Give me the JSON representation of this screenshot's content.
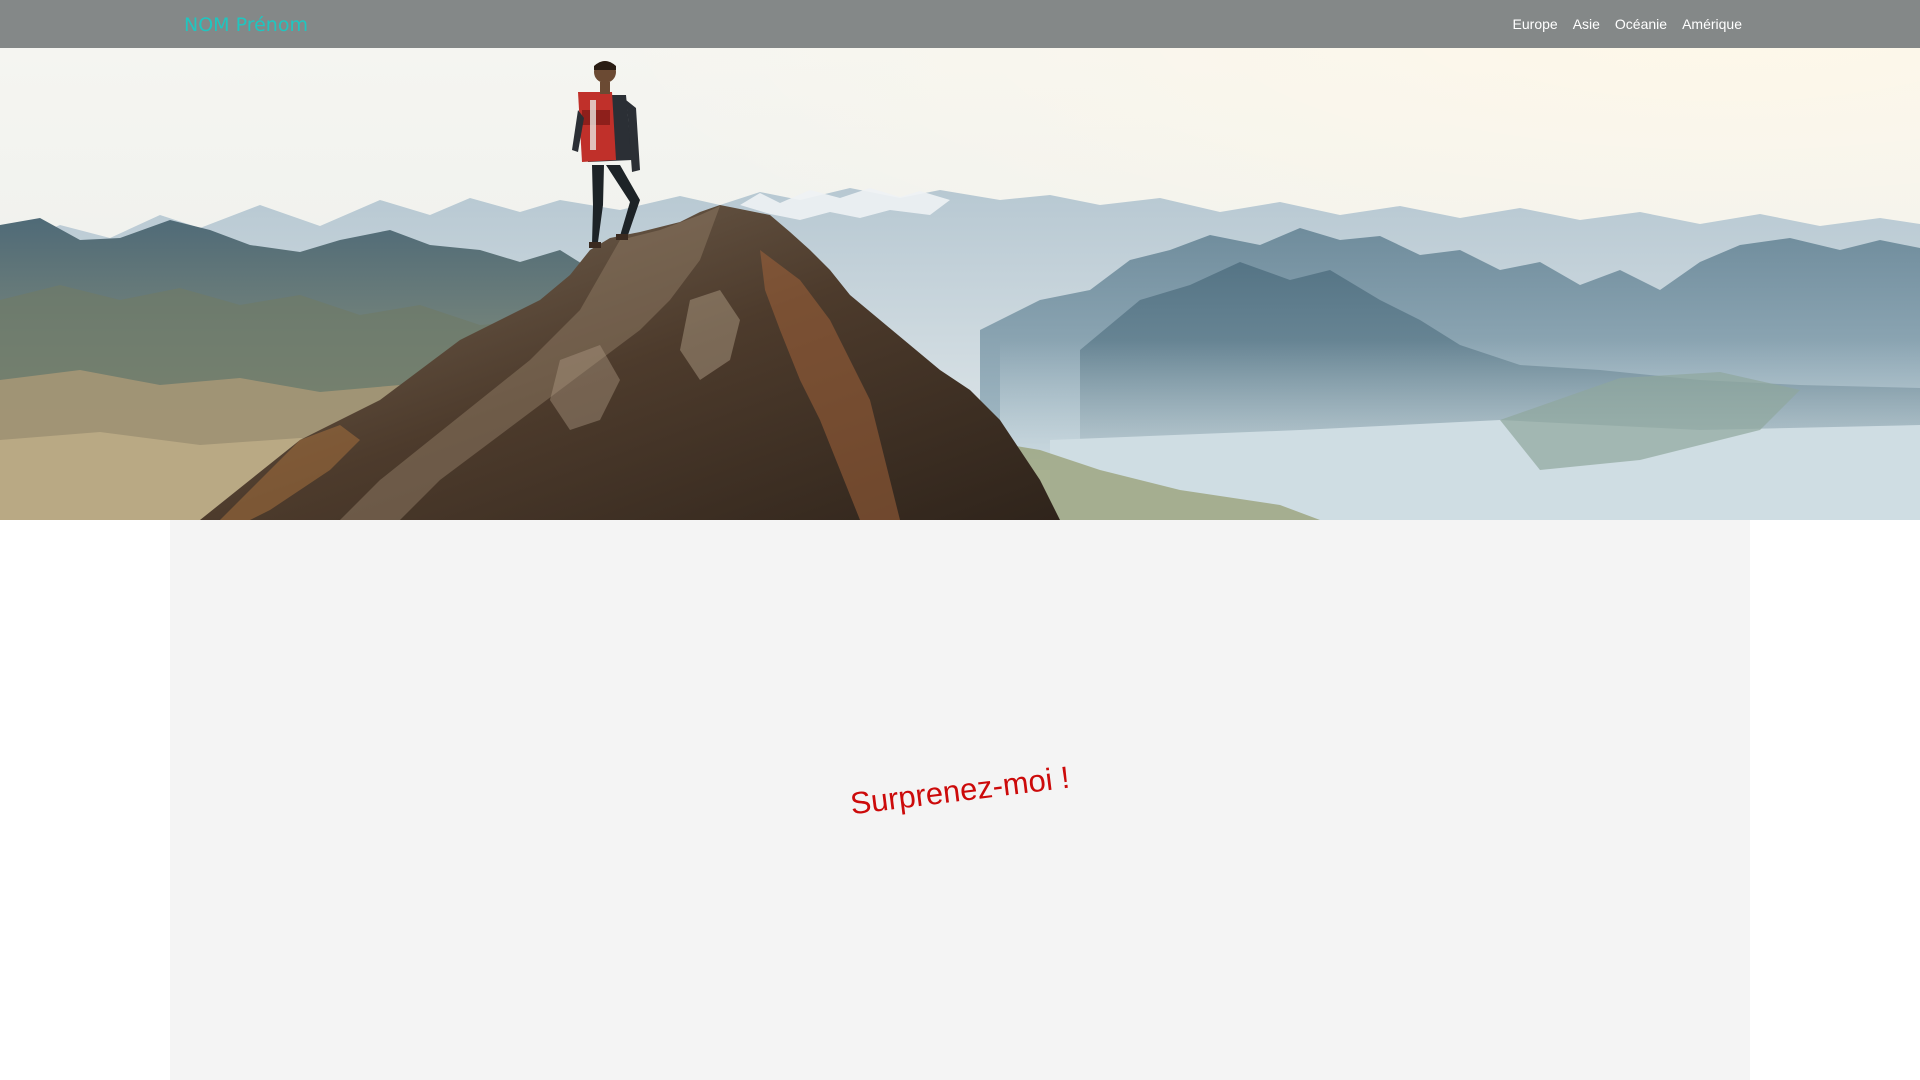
{
  "navbar": {
    "brand": "NOM Prénom",
    "links": [
      {
        "label": "Europe"
      },
      {
        "label": "Asie"
      },
      {
        "label": "Océanie"
      },
      {
        "label": "Amérique"
      }
    ]
  },
  "content": {
    "message": "Surprenez-moi !"
  },
  "colors": {
    "brand": "#1fc6c0",
    "navbar_bg": "#808484",
    "message": "#cc0a0a",
    "panel_bg": "#f4f4f4"
  }
}
